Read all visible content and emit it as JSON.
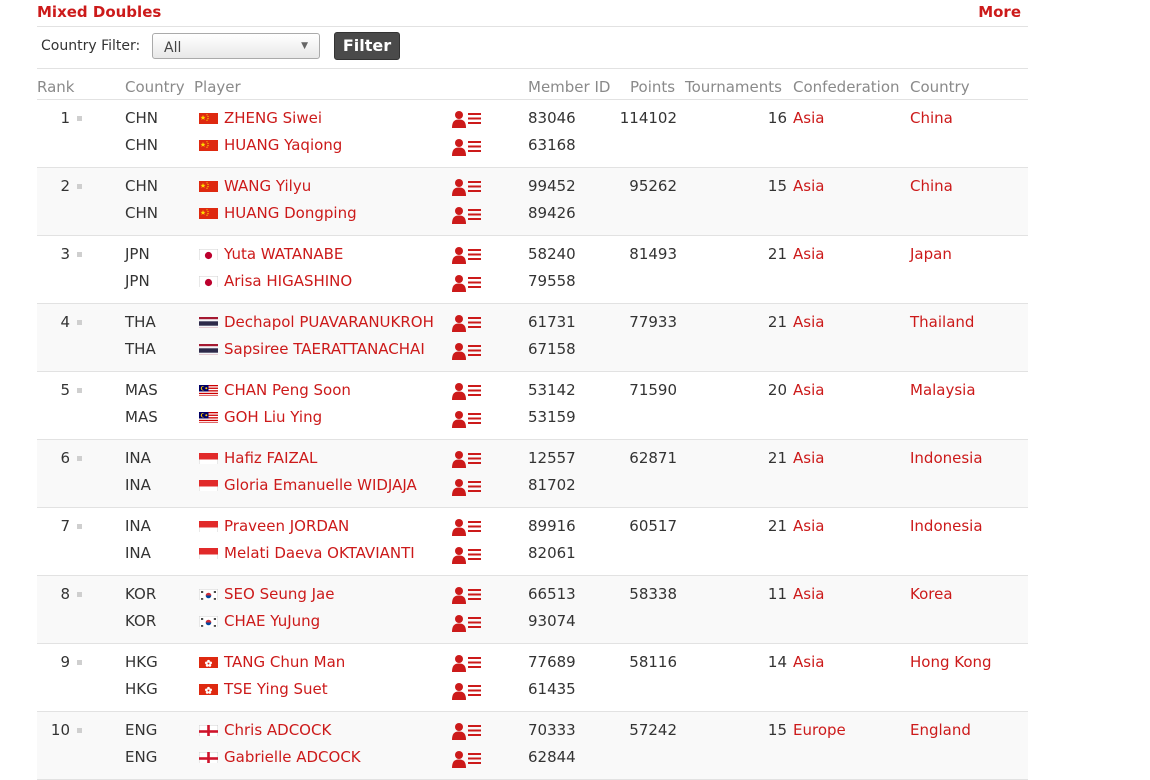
{
  "section": {
    "title": "Mixed Doubles",
    "more": "More"
  },
  "filter": {
    "label": "Country Filter:",
    "selected": "All",
    "button": "Filter"
  },
  "columns": {
    "rank": "Rank",
    "country_code": "Country",
    "player": "Player",
    "member_id": "Member ID",
    "points": "Points",
    "tournaments": "Tournaments",
    "confederation": "Confederation",
    "country": "Country"
  },
  "rankings": [
    {
      "rank": "1",
      "points": "114102",
      "tournaments": "16",
      "confederation": "Asia",
      "country": "China",
      "players": [
        {
          "code": "CHN",
          "flag": "china-flag-icon",
          "name": "ZHENG Siwei",
          "member_id": "83046"
        },
        {
          "code": "CHN",
          "flag": "china-flag-icon",
          "name": "HUANG Yaqiong",
          "member_id": "63168"
        }
      ]
    },
    {
      "rank": "2",
      "points": "95262",
      "tournaments": "15",
      "confederation": "Asia",
      "country": "China",
      "players": [
        {
          "code": "CHN",
          "flag": "china-flag-icon",
          "name": "WANG Yilyu",
          "member_id": "99452"
        },
        {
          "code": "CHN",
          "flag": "china-flag-icon",
          "name": "HUANG Dongping",
          "member_id": "89426"
        }
      ]
    },
    {
      "rank": "3",
      "points": "81493",
      "tournaments": "21",
      "confederation": "Asia",
      "country": "Japan",
      "players": [
        {
          "code": "JPN",
          "flag": "japan-flag-icon",
          "name": "Yuta WATANABE",
          "member_id": "58240"
        },
        {
          "code": "JPN",
          "flag": "japan-flag-icon",
          "name": "Arisa HIGASHINO",
          "member_id": "79558"
        }
      ]
    },
    {
      "rank": "4",
      "points": "77933",
      "tournaments": "21",
      "confederation": "Asia",
      "country": "Thailand",
      "players": [
        {
          "code": "THA",
          "flag": "thailand-flag-icon",
          "name": "Dechapol PUAVARANUKROH",
          "member_id": "61731"
        },
        {
          "code": "THA",
          "flag": "thailand-flag-icon",
          "name": "Sapsiree TAERATTANACHAI",
          "member_id": "67158"
        }
      ]
    },
    {
      "rank": "5",
      "points": "71590",
      "tournaments": "20",
      "confederation": "Asia",
      "country": "Malaysia",
      "players": [
        {
          "code": "MAS",
          "flag": "malaysia-flag-icon",
          "name": "CHAN Peng Soon",
          "member_id": "53142"
        },
        {
          "code": "MAS",
          "flag": "malaysia-flag-icon",
          "name": "GOH Liu Ying",
          "member_id": "53159"
        }
      ]
    },
    {
      "rank": "6",
      "points": "62871",
      "tournaments": "21",
      "confederation": "Asia",
      "country": "Indonesia",
      "players": [
        {
          "code": "INA",
          "flag": "indonesia-flag-icon",
          "name": "Hafiz FAIZAL",
          "member_id": "12557"
        },
        {
          "code": "INA",
          "flag": "indonesia-flag-icon",
          "name": "Gloria Emanuelle WIDJAJA",
          "member_id": "81702"
        }
      ]
    },
    {
      "rank": "7",
      "points": "60517",
      "tournaments": "21",
      "confederation": "Asia",
      "country": "Indonesia",
      "players": [
        {
          "code": "INA",
          "flag": "indonesia-flag-icon",
          "name": "Praveen JORDAN",
          "member_id": "89916"
        },
        {
          "code": "INA",
          "flag": "indonesia-flag-icon",
          "name": "Melati Daeva OKTAVIANTI",
          "member_id": "82061"
        }
      ]
    },
    {
      "rank": "8",
      "points": "58338",
      "tournaments": "11",
      "confederation": "Asia",
      "country": "Korea",
      "players": [
        {
          "code": "KOR",
          "flag": "korea-flag-icon",
          "name": "SEO Seung Jae",
          "member_id": "66513"
        },
        {
          "code": "KOR",
          "flag": "korea-flag-icon",
          "name": "CHAE YuJung",
          "member_id": "93074"
        }
      ]
    },
    {
      "rank": "9",
      "points": "58116",
      "tournaments": "14",
      "confederation": "Asia",
      "country": "Hong Kong",
      "players": [
        {
          "code": "HKG",
          "flag": "hongkong-flag-icon",
          "name": "TANG Chun Man",
          "member_id": "77689"
        },
        {
          "code": "HKG",
          "flag": "hongkong-flag-icon",
          "name": "TSE Ying Suet",
          "member_id": "61435"
        }
      ]
    },
    {
      "rank": "10",
      "points": "57242",
      "tournaments": "15",
      "confederation": "Europe",
      "country": "England",
      "players": [
        {
          "code": "ENG",
          "flag": "england-flag-icon",
          "name": "Chris ADCOCK",
          "member_id": "70333"
        },
        {
          "code": "ENG",
          "flag": "england-flag-icon",
          "name": "Gabrielle ADCOCK",
          "member_id": "62844"
        }
      ]
    }
  ],
  "colors": {
    "accent": "#cc1a1a",
    "row_alt": "#f9f9f9",
    "divider": "#e2e2e2"
  }
}
